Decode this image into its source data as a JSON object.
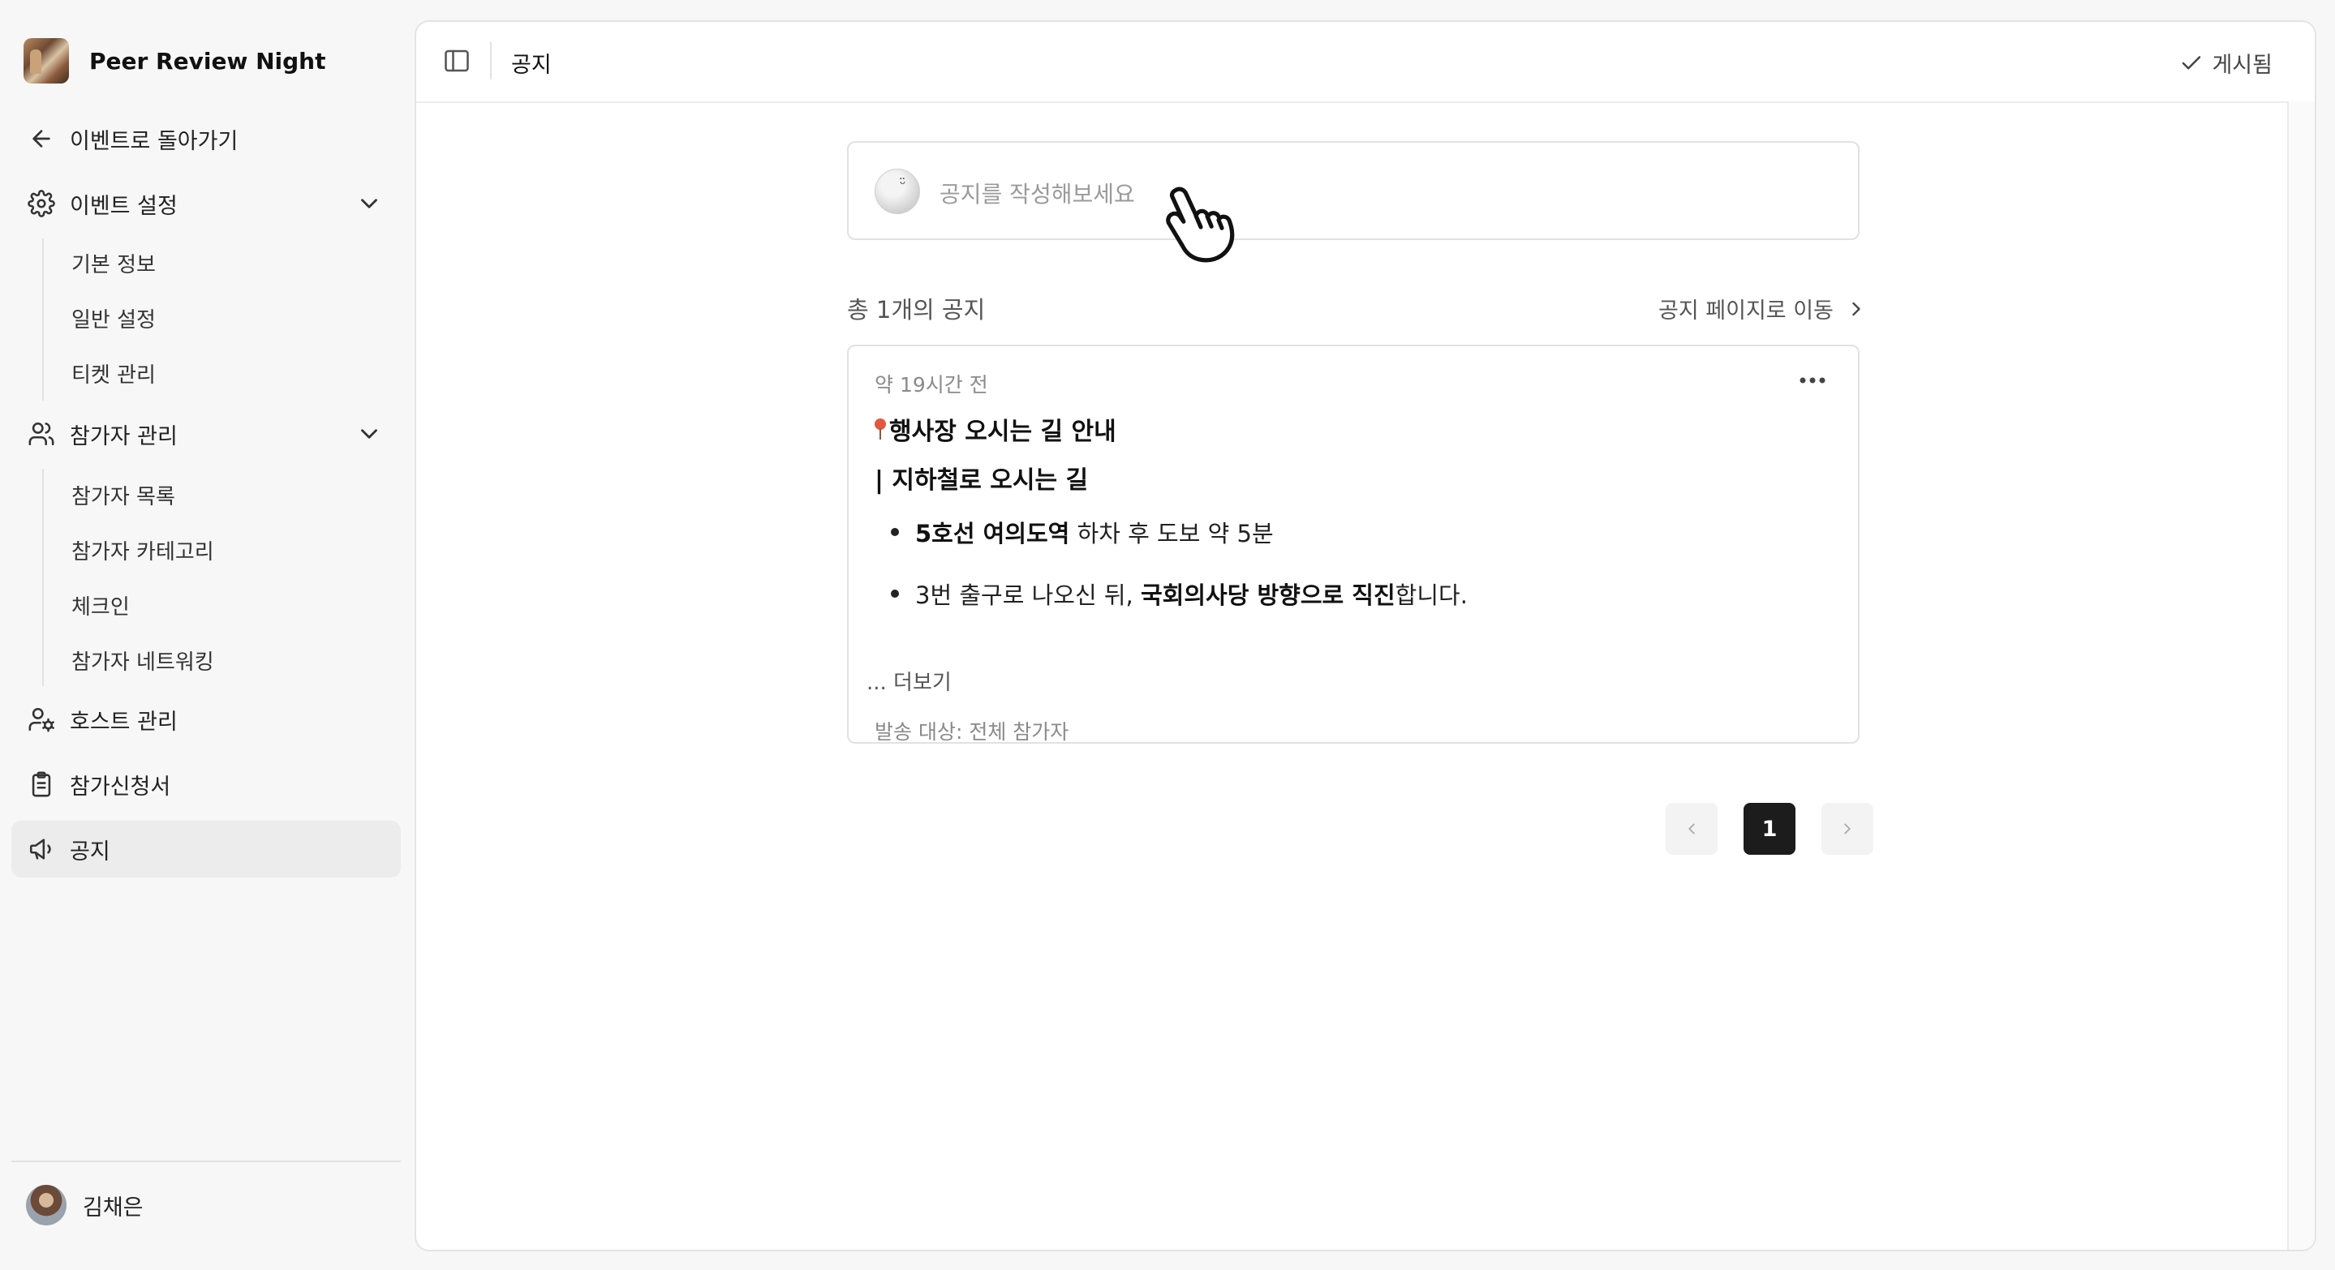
{
  "event": {
    "title": "Peer Review Night"
  },
  "nav": {
    "back_label": "이벤트로 돌아가기",
    "event_settings": {
      "label": "이벤트 설정",
      "items": [
        "기본 정보",
        "일반 설정",
        "티켓 관리"
      ]
    },
    "participants": {
      "label": "참가자 관리",
      "items": [
        "참가자 목록",
        "참가자 카테고리",
        "체크인",
        "참가자 네트워킹"
      ]
    },
    "host_label": "호스트 관리",
    "application_label": "참가신청서",
    "notice_label": "공지"
  },
  "user": {
    "name": "김채은"
  },
  "topbar": {
    "title": "공지",
    "status_label": "게시됨"
  },
  "composer": {
    "placeholder": "공지를 작성해보세요"
  },
  "list": {
    "count_text": "총 1개의 공지",
    "goto_label": "공지 페이지로 이동"
  },
  "notice": {
    "time": "약 19시간 전",
    "heading": "행사장 오시는 길 안내",
    "subheading": "| 지하철로 오시는 길",
    "bullet1_bold": "5호선 여의도역",
    "bullet1_rest": " 하차 후 도보 약 5분",
    "bullet2_pre": "3번 출구로 나오신 뒤, ",
    "bullet2_bold": "국회의사당 방향으로 직진",
    "bullet2_post": "합니다.",
    "read_more": "... 더보기",
    "audience": "발송 대상: 전체 참가자"
  },
  "pagination": {
    "current": "1"
  }
}
